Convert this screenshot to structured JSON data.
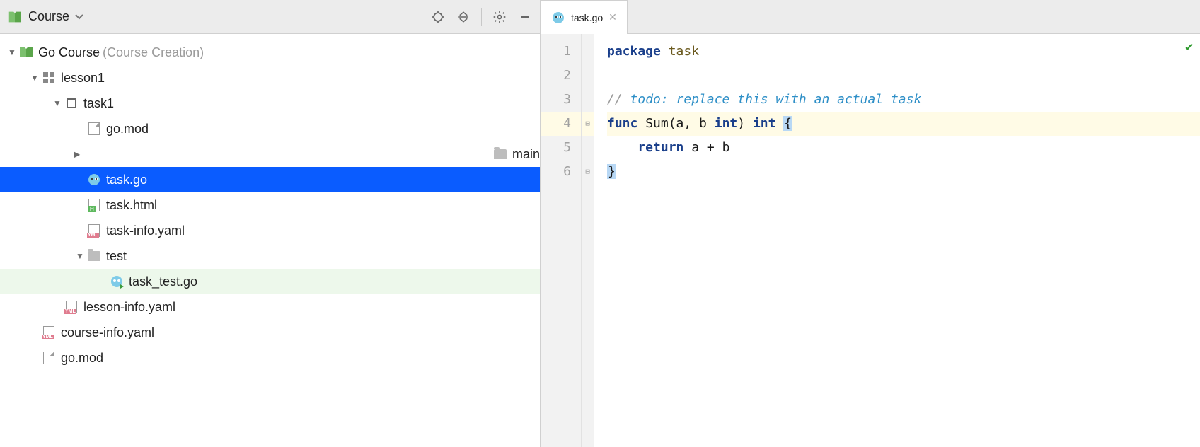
{
  "toolbar": {
    "title": "Course"
  },
  "tree": {
    "root": {
      "label": "Go Course",
      "annotation": "(Course Creation)"
    },
    "lesson": "lesson1",
    "task": "task1",
    "items": {
      "gomod": "go.mod",
      "main": "main",
      "taskgo": "task.go",
      "taskhtml": "task.html",
      "taskinfo": "task-info.yaml",
      "test": "test",
      "tasktest": "task_test.go",
      "lessoninfo": "lesson-info.yaml",
      "courseinfo": "course-info.yaml",
      "rootgomod": "go.mod"
    }
  },
  "tab": {
    "filename": "task.go"
  },
  "editor": {
    "lines": [
      "1",
      "2",
      "3",
      "4",
      "5",
      "6"
    ],
    "code": {
      "l1_kw": "package",
      "l1_id": " task",
      "l3_cm1": "// ",
      "l3_cm2": "todo: replace this with an actual task",
      "l4_kw1": "func ",
      "l4_fn": "Sum",
      "l4_sig1": "(a, b ",
      "l4_kw2": "int",
      "l4_sig2": ") ",
      "l4_kw3": "int",
      "l4_sp": " ",
      "l4_br": "{",
      "l5_kw": "    return ",
      "l5_expr": "a + b",
      "l6_br": "}"
    }
  }
}
